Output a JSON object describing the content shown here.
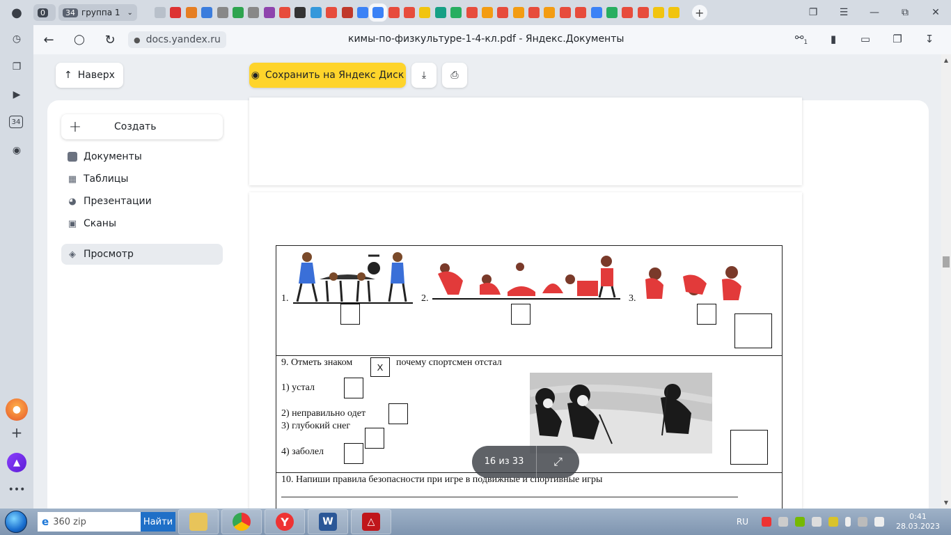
{
  "tabstrip": {
    "count_zero": "0",
    "group_count": "34",
    "group_name": "группа 1",
    "tab_colors": [
      "#b8c0ca",
      "#d33",
      "#e67e22",
      "#3b7ddd",
      "#888",
      "#2ea44f",
      "#888",
      "#8e44ad",
      "#e74c3c",
      "#333",
      "#3498db",
      "#e74c3c",
      "#c0392b",
      "#3b82f6",
      "#3b82f6",
      "#e74c3c",
      "#e74c3c",
      "#f1c40f",
      "#16a085",
      "#27ae60",
      "#e74c3c",
      "#f39c12",
      "#e74c3c",
      "#f39c12",
      "#e74c3c",
      "#f39c12",
      "#e74c3c",
      "#e74c3c",
      "#3b82f6",
      "#27ae60",
      "#e74c3c",
      "#e74c3c",
      "#f1c40f",
      "#f1c40f"
    ],
    "active_tab_index": 14
  },
  "addressbar": {
    "domain": "docs.yandex.ru",
    "title": "кимы-по-физкультуре-1-4-кл.pdf - Яндекс.Документы",
    "extension_badge": "1"
  },
  "toolbar": {
    "back_top": "Наверх",
    "save_disk": "Сохранить на Яндекс Диск"
  },
  "sidebar": {
    "create": "Создать",
    "items": [
      {
        "label": "Документы"
      },
      {
        "label": "Таблицы"
      },
      {
        "label": "Презентации"
      },
      {
        "label": "Сканы"
      },
      {
        "label": "Просмотр"
      }
    ]
  },
  "document": {
    "row1": {
      "n1": "1.",
      "n2": "2.",
      "n3": "3."
    },
    "q9": {
      "prompt_a": "9. Отметь знаком",
      "mark": "Х",
      "prompt_b": "почему спортсмен отстал",
      "options": [
        "1) устал",
        "2) неправильно одет",
        "3) глубокий снег",
        "4) заболел"
      ]
    },
    "q10": {
      "prompt": "10. Напиши правила безопасности при игре в подвижные и спортивные игры"
    }
  },
  "pager": {
    "text": "16 из 33"
  },
  "taskbar": {
    "search_text": "360 zip",
    "search_button": "Найти",
    "lang": "RU",
    "time": "0:41",
    "date": "28.03.2023"
  }
}
